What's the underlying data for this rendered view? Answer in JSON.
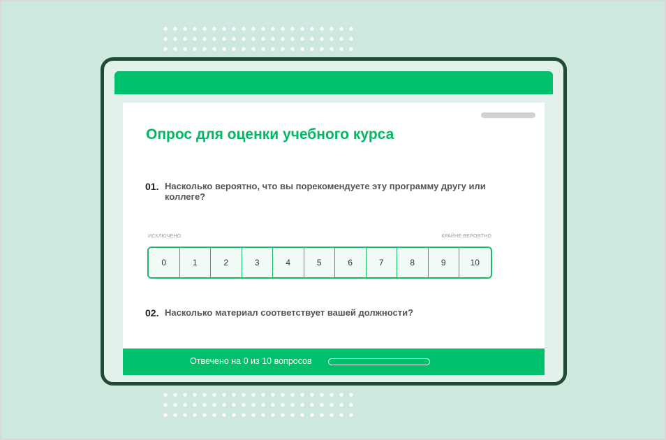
{
  "survey": {
    "title": "Опрос для оценки учебного курса"
  },
  "questions": [
    {
      "number": "01.",
      "text": "Насколько вероятно, что вы порекомендуете эту программу другу или коллеге?",
      "scale": {
        "min_label": "ИСКЛЮЧЕНО",
        "max_label": "КРАЙНЕ ВЕРОЯТНО",
        "options": [
          "0",
          "1",
          "2",
          "3",
          "4",
          "5",
          "6",
          "7",
          "8",
          "9",
          "10"
        ]
      }
    },
    {
      "number": "02.",
      "text": "Насколько материал соответствует вашей должности?"
    }
  ],
  "progress": {
    "text": "Отвечено на 0 из 10 вопросов",
    "fraction": 0
  },
  "colors": {
    "accent": "#00c06b",
    "background": "#cde8dc",
    "frame": "#1f4a36"
  }
}
